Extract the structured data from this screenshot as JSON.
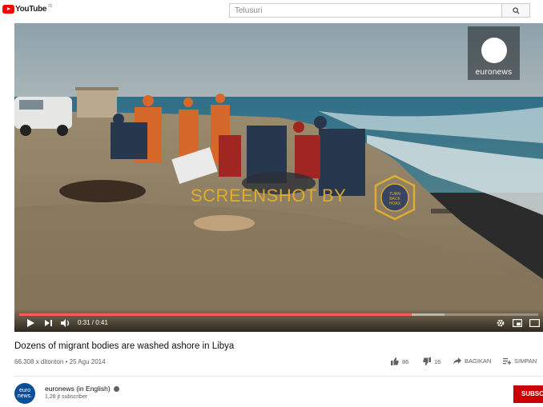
{
  "header": {
    "logo_text": "YouTube",
    "logo_sup": "ID",
    "search_placeholder": "Telusuri",
    "search_icon": "search-icon"
  },
  "player": {
    "overlay_watermark": "SCREENSHOT BY",
    "channel_logo_text": "euronews",
    "badge_text": "TURN BACK HOAX",
    "current_time": "0:31 / 0:41",
    "progress_fraction": 0.756,
    "buffered_fraction": 0.82,
    "colors": {
      "progress": "#ff0000",
      "watermark": "#e9b229"
    }
  },
  "video": {
    "title": "Dozens of migrant bodies are washed ashore in Libya",
    "meta": "66.308 x ditonton • 25 Agu 2014",
    "likes": "86",
    "dislikes": "16",
    "share_label": "BAGIKAN",
    "save_label": "SIMPAN"
  },
  "channel": {
    "avatar_text": "euro news.",
    "name": "euronews (in English)",
    "subscribers": "1,28 jt subscriber",
    "subscribe_label": "SUBSCR"
  }
}
